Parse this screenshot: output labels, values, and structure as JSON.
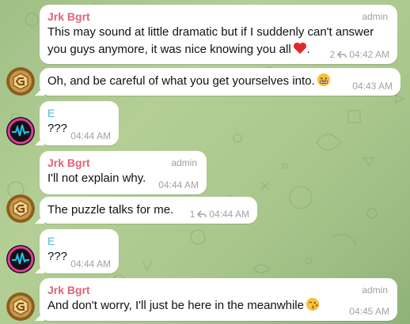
{
  "messages": [
    {
      "sender": "Jrk Bgrt",
      "role": "admin",
      "text": "This may sound at little dramatic but if I suddenly can't answer",
      "text2": "you guys anymore, it was nice knowing you all",
      "replies": "2",
      "time": "04:42 AM"
    },
    {
      "text": "Oh, and be careful of what you get yourselves into.",
      "time": "04:43 AM"
    },
    {
      "sender": "E",
      "text": "???",
      "time": "04:44 AM"
    },
    {
      "sender": "Jrk Bgrt",
      "role": "admin",
      "text": "I'll not explain why.",
      "time": "04:44 AM"
    },
    {
      "text": "The puzzle talks for me.",
      "replies": "1",
      "time": "04:44 AM"
    },
    {
      "sender": "E",
      "text": "???",
      "time": "04:44 AM"
    },
    {
      "sender": "Jrk Bgrt",
      "role": "admin",
      "text": "And don't worry, I'll just be here in the meanwhile",
      "time": "04:45 AM"
    }
  ],
  "colors": {
    "admin_name": "#e0647a",
    "user_e_name": "#4cb7d8",
    "bubble": "#ffffff",
    "meta": "#a3a3a3"
  },
  "icons": {
    "reply": "reply-arrow-icon",
    "heart": "red-heart-emoji",
    "worried": "grimacing-emoji",
    "kiss": "kissing-emoji"
  }
}
